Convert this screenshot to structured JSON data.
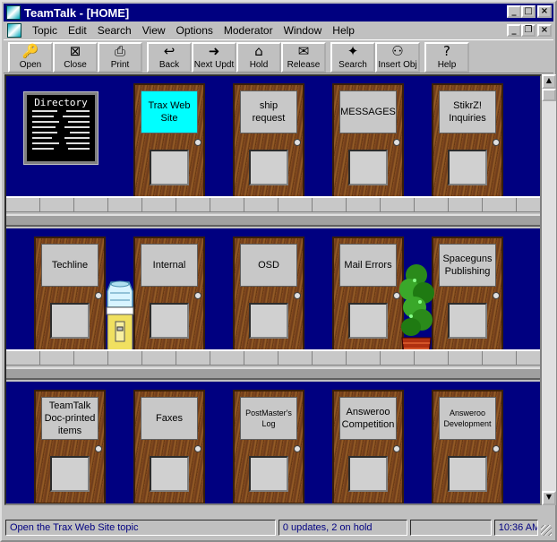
{
  "window": {
    "title": "TeamTalk - [HOME]"
  },
  "menu": [
    "Topic",
    "Edit",
    "Search",
    "View",
    "Options",
    "Moderator",
    "Window",
    "Help"
  ],
  "toolbar": [
    {
      "label": "Open",
      "icon": "open-icon",
      "glyph": "🔑"
    },
    {
      "label": "Close",
      "icon": "close-door-icon",
      "glyph": "⊠"
    },
    {
      "label": "Print",
      "icon": "printer-icon",
      "glyph": "⎙"
    },
    {
      "label": "Back",
      "icon": "back-arrow-icon",
      "glyph": "↩"
    },
    {
      "label": "Next Updt",
      "icon": "next-update-icon",
      "glyph": "➜"
    },
    {
      "label": "Hold",
      "icon": "hold-icon",
      "glyph": "⌂"
    },
    {
      "label": "Release",
      "icon": "release-icon",
      "glyph": "✉"
    },
    {
      "label": "Search",
      "icon": "search-icon",
      "glyph": "✦"
    },
    {
      "label": "Insert Obj",
      "icon": "insert-object-icon",
      "glyph": "⚇"
    },
    {
      "label": "Help",
      "icon": "help-icon",
      "glyph": "?"
    }
  ],
  "directory": {
    "title": "Directory"
  },
  "doors": [
    {
      "label": "Trax Web Site",
      "highlighted": true
    },
    {
      "label": "ship request"
    },
    {
      "label": "MESSAGES"
    },
    {
      "label": "StikrZ! Inquiries"
    },
    {
      "label": "Techline"
    },
    {
      "label": "Internal"
    },
    {
      "label": "OSD"
    },
    {
      "label": "Mail Errors"
    },
    {
      "label": "Spaceguns Publishing"
    },
    {
      "label": "TeamTalk Doc-printed items"
    },
    {
      "label": "Faxes"
    },
    {
      "label": "PostMaster's Log"
    },
    {
      "label": "Answeroo Competition"
    },
    {
      "label": "Answeroo Development"
    }
  ],
  "status": {
    "message": "Open the Trax Web Site topic",
    "updates": "0 updates, 2 on hold",
    "time": "10:36 AM"
  }
}
